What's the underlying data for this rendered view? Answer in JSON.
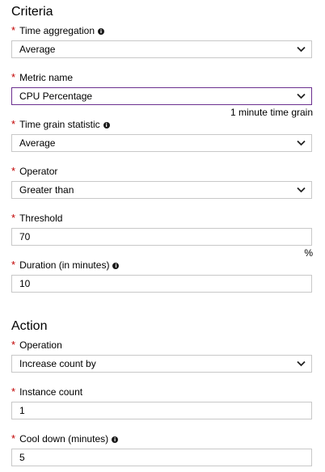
{
  "criteria": {
    "title": "Criteria",
    "time_aggregation": {
      "label": "Time aggregation",
      "value": "Average"
    },
    "metric_name": {
      "label": "Metric name",
      "value": "CPU Percentage",
      "hint": "1 minute time grain"
    },
    "time_grain_statistic": {
      "label": "Time grain statistic",
      "value": "Average"
    },
    "operator": {
      "label": "Operator",
      "value": "Greater than"
    },
    "threshold": {
      "label": "Threshold",
      "value": "70",
      "unit": "%"
    },
    "duration": {
      "label": "Duration (in minutes)",
      "value": "10"
    }
  },
  "action": {
    "title": "Action",
    "operation": {
      "label": "Operation",
      "value": "Increase count by"
    },
    "instance_count": {
      "label": "Instance count",
      "value": "1"
    },
    "cool_down": {
      "label": "Cool down (minutes)",
      "value": "5"
    }
  },
  "required_mark": "*",
  "info_glyph": "i",
  "colors": {
    "required": "#c00000",
    "focus_border": "#6b2f8f",
    "field_border": "#c8c8c8"
  }
}
